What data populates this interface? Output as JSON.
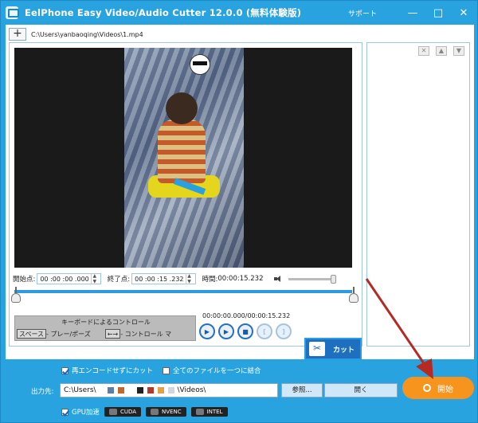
{
  "window": {
    "title": "EelPhone Easy Video/Audio Cutter 12.0.0 (無料体験版)",
    "support": "サポート",
    "minimize": "—",
    "maximize": "□",
    "close": "✕"
  },
  "file": {
    "add": "+",
    "path": "C:\\Users\\yanbaoqing\\Videos\\1.mp4"
  },
  "times": {
    "start_label": "開始点:",
    "start_value": "00 :00 :00 .000",
    "end_label": "終了点:",
    "end_value": "00 :00 :15 .232",
    "duration_label": "時間:",
    "duration_value": "00:00:15.232",
    "total": "00:00:00.000/00:00:15.232"
  },
  "volume": {
    "level": 1.0
  },
  "keyboard": {
    "title": "キーボードによるコントロール",
    "space_key": "スペース",
    "space_desc": "- プレー/ポーズ",
    "arrow_keys": "←→",
    "arrow_desc": "- コントロール マ"
  },
  "controls": {
    "play": "▶",
    "play_seg": "▶",
    "stop": "■",
    "mark_in": "[",
    "mark_out": "]"
  },
  "cut": {
    "label": "カット",
    "icon": "✂"
  },
  "side": {
    "delete": "✕",
    "up": "▲",
    "down": "▼"
  },
  "bottom": {
    "no_reencode": "再エンコードせずにカット",
    "merge_all": "全てのファイルを一つに結合",
    "output_label": "出力先:",
    "output_prefix": "C:\\Users\\",
    "output_suffix": "\\Videos\\",
    "browse": "参照...",
    "open": "開く",
    "start": "開始",
    "gpu_label": "GPU加速",
    "gpu_cuda": "CUDA",
    "gpu_nvenc": "NVENC",
    "gpu_intel": "INTEL"
  },
  "colors": {
    "accent": "#29a3e0",
    "start_button": "#f7941d",
    "annotation_arrow": "#b52a22"
  }
}
